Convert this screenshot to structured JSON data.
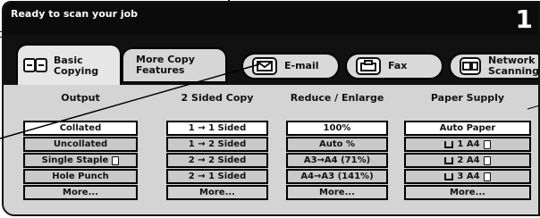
{
  "status": {
    "message": "Ready to scan your job",
    "copy_count": "1"
  },
  "tabs": {
    "basic": {
      "line1": "Basic",
      "line2": "Copying"
    },
    "more": {
      "line1": "More Copy",
      "line2": "Features"
    },
    "email": "E-mail",
    "fax": "Fax",
    "network": {
      "line1": "Network",
      "line2": "Scanning"
    }
  },
  "columns": {
    "output": {
      "title": "Output",
      "options": [
        "Collated",
        "Uncollated",
        "Single Staple",
        "Hole Punch",
        "More..."
      ],
      "selected_index": 0
    },
    "two_sided": {
      "title": "2 Sided Copy",
      "options": [
        "1 → 1 Sided",
        "1 → 2 Sided",
        "2 → 2 Sided",
        "2 → 1 Sided",
        "More..."
      ],
      "selected_index": 0
    },
    "reduce": {
      "title": "Reduce / Enlarge",
      "options": [
        "100%",
        "Auto %",
        "A3→A4 (71%)",
        "A4→A3 (141%)",
        "More..."
      ],
      "selected_index": 0
    },
    "paper": {
      "title": "Paper Supply",
      "options": [
        "Auto Paper",
        "1 A4",
        "2 A4",
        "3 A4",
        "More..."
      ],
      "selected_index": 0
    }
  },
  "icons": {
    "basic_tab": "copier-icon",
    "email_tab": "email-scan-icon",
    "fax_tab": "fax-icon",
    "network_tab": "network-scan-icon",
    "staple": "document-icon",
    "tray": "paper-tray-icon"
  }
}
